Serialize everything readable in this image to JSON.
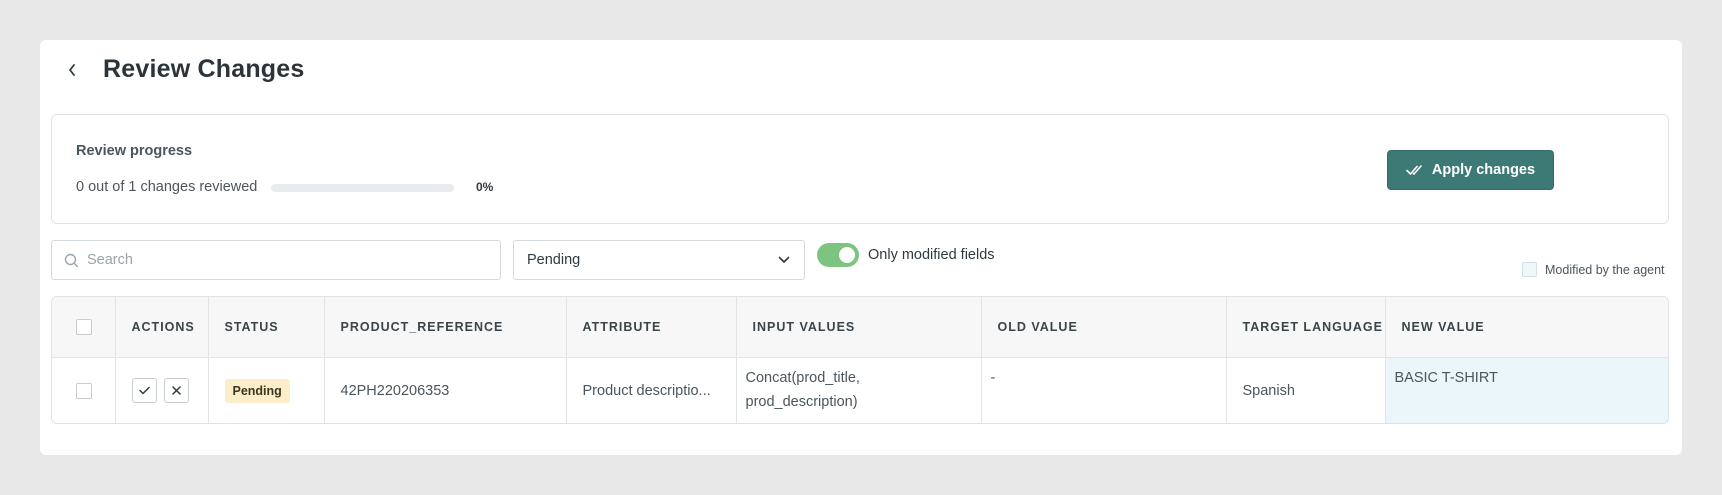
{
  "header": {
    "title": "Review Changes",
    "back_icon": "chevron-left-icon"
  },
  "progress": {
    "heading": "Review progress",
    "summary": "0 out of 1 changes reviewed",
    "percent_label": "0%",
    "percent_value": 0,
    "apply_label": "Apply changes",
    "apply_icon": "double-check-icon",
    "accent": "#3d7a76"
  },
  "filters": {
    "search_placeholder": "Search",
    "status_selected": "Pending",
    "toggle_label": "Only modified fields",
    "toggle_on": true,
    "toggle_color": "#7cc47f",
    "legend_label": "Modified by the agent"
  },
  "table": {
    "columns": [
      "ACTIONS",
      "STATUS",
      "PRODUCT_REFERENCE",
      "ATTRIBUTE",
      "INPUT VALUES",
      "OLD VALUE",
      "TARGET LANGUAGE",
      "NEW VALUE"
    ],
    "rows": [
      {
        "status": "Pending",
        "product_reference": "42PH220206353",
        "attribute": "Product descriptio...",
        "input_values": [
          "Concat(prod_title,",
          "prod_description)"
        ],
        "old_value": "-",
        "target_language": "Spanish",
        "new_value": "BASIC T-SHIRT"
      }
    ]
  }
}
